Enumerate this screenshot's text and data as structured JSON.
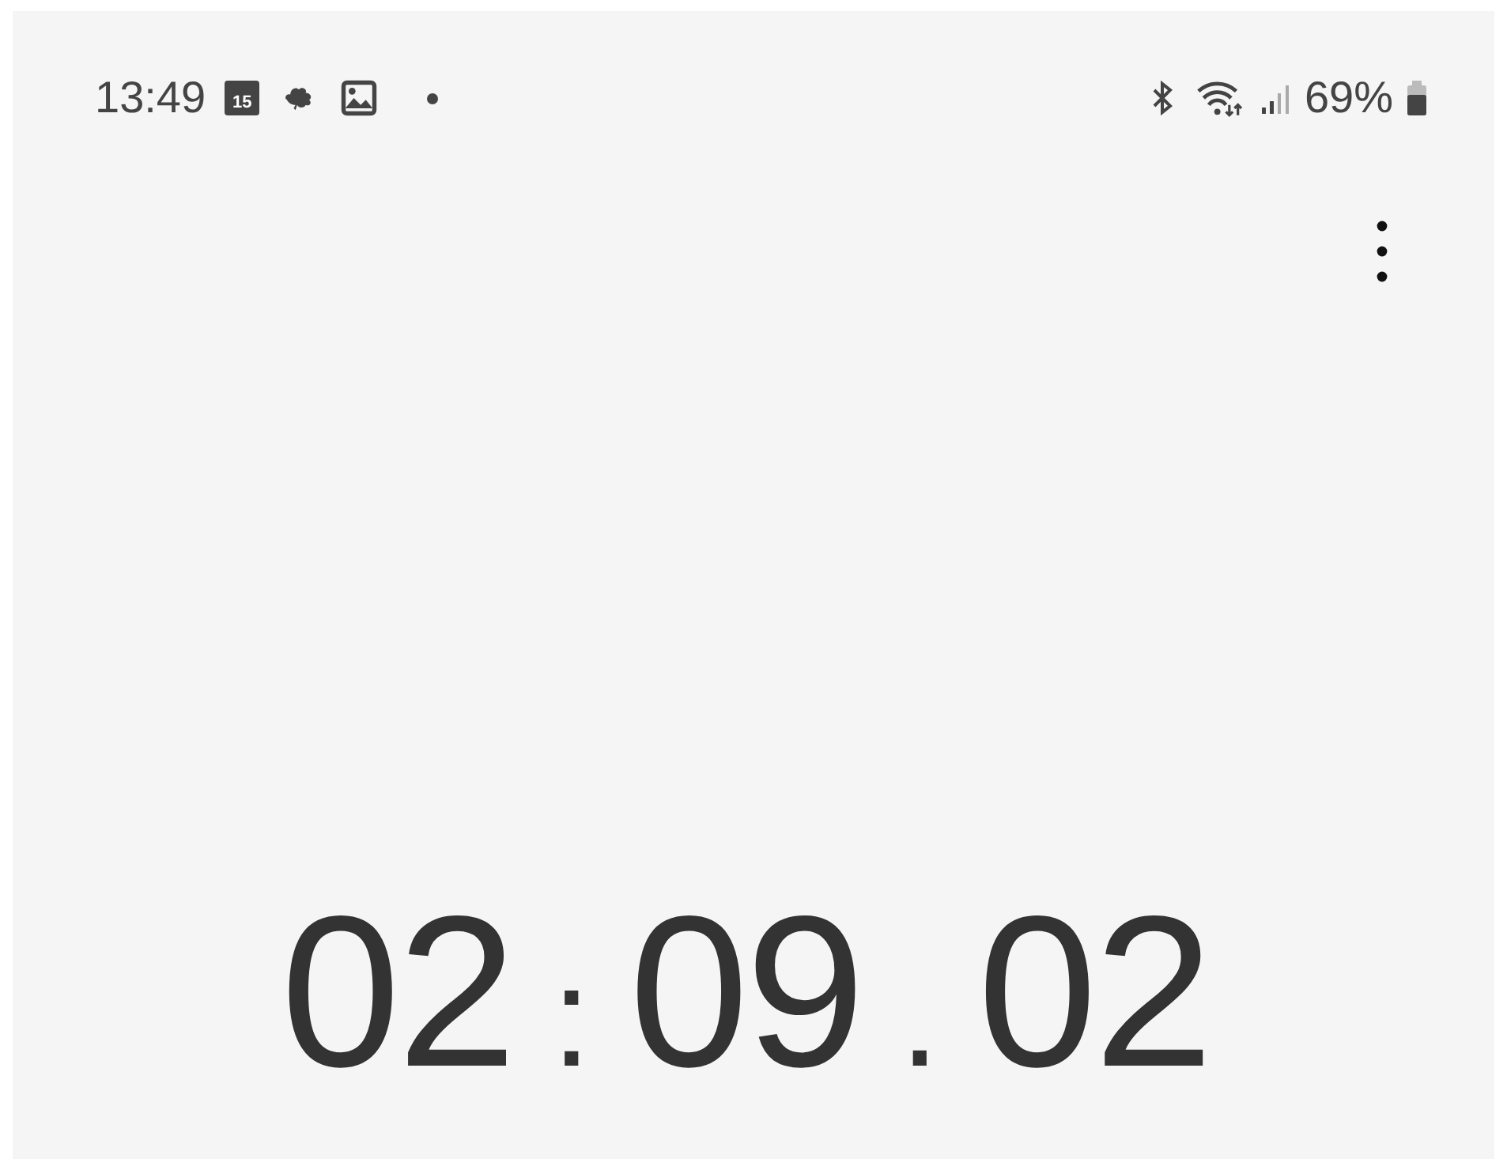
{
  "status_bar": {
    "time": "13:49",
    "calendar_day": "15",
    "battery": "69%"
  },
  "timer": {
    "minutes": "02",
    "separator_1": ":",
    "seconds": "09",
    "separator_2": ".",
    "hundredths": "02"
  }
}
